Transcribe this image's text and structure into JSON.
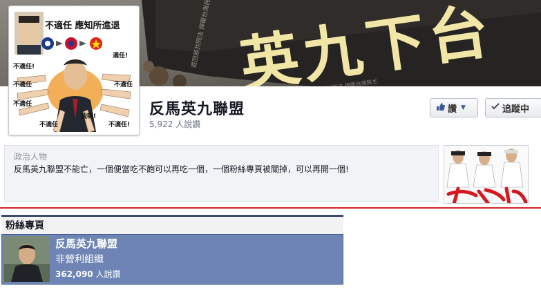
{
  "cover": {
    "banner_text": "英九下台",
    "small_caption_1": "退回原共同法 捍衛台灣民主",
    "small_caption_2": "退回原共同法 捍衛台灣民主"
  },
  "profile_picture": {
    "headline": "不適任 應知所進退",
    "hand_labels": [
      "不適任!",
      "適任!",
      "不適任",
      "不適任",
      "不適任",
      "我呢!",
      "不適任",
      "不適任!"
    ]
  },
  "page": {
    "name": "反馬英九聯盟",
    "likes": "5,922 人說讚"
  },
  "buttons": {
    "like_label": "讚",
    "follow_label": "追蹤中"
  },
  "about": {
    "category": "政治人物",
    "description": "反馬英九聯盟不能亡，一個便當吃不飽可以再吃一個，一個粉絲專頁被關掉，可以再開一個!"
  },
  "fan_pages": {
    "heading": "粉絲專頁",
    "items": [
      {
        "name": "反馬英九聯盟",
        "type": "非營利組織",
        "likes_count": "362,090",
        "likes_suffix": " 人說讚"
      }
    ]
  },
  "icons": {
    "like": "thumbs-up-icon",
    "dropdown": "chevron-down-icon",
    "follow": "check-icon"
  },
  "colors": {
    "accent_blue": "#3b5998",
    "fan_row_bg": "#6d84b4",
    "red_rule": "#d02327"
  }
}
